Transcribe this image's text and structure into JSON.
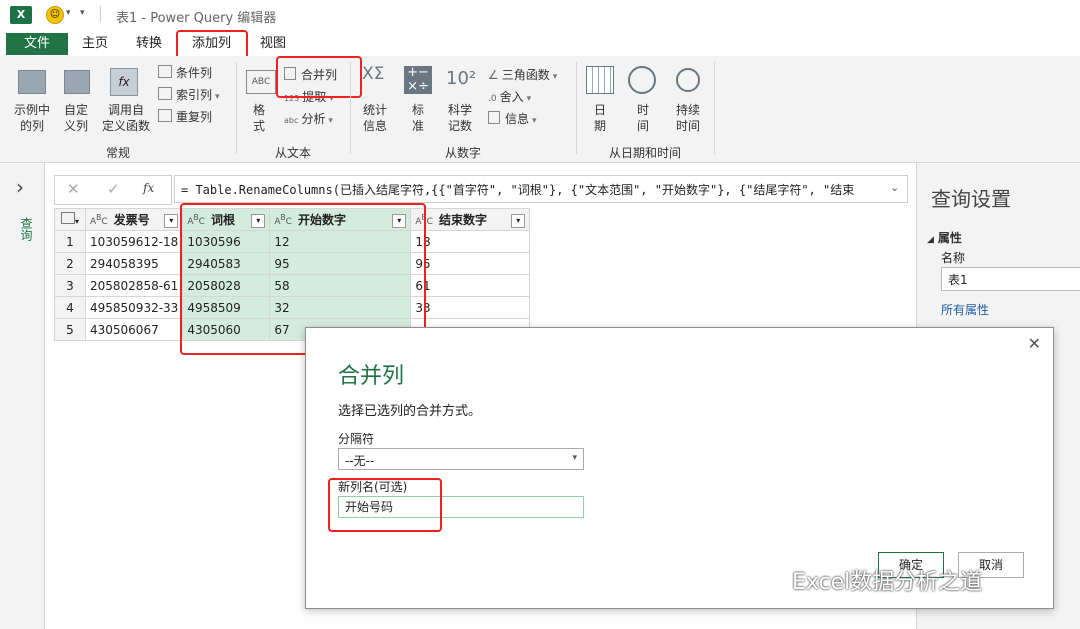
{
  "window": {
    "title": "表1 - Power Query 编辑器",
    "app_badge": "X"
  },
  "tabs": [
    "文件",
    "主页",
    "转换",
    "添加列",
    "视图"
  ],
  "ribbon": {
    "general": {
      "label": "常规",
      "btn_example": [
        "示例中",
        "的列"
      ],
      "btn_custom": [
        "自定",
        "义列"
      ],
      "btn_invoke": [
        "调用自",
        "定义函数"
      ],
      "small_items": [
        "条件列",
        "索引列",
        "重复列"
      ]
    },
    "text": {
      "label": "从文本",
      "btn_format": [
        "格",
        "式"
      ],
      "small_items": [
        "合并列",
        "提取",
        "分析"
      ],
      "abc_tag": "ABC",
      "num_tag": "123"
    },
    "number": {
      "label": "从数字",
      "btn_stats": [
        "统计",
        "信息"
      ],
      "btn_standard": [
        "标",
        "准"
      ],
      "btn_scientific": [
        "科学",
        "记数"
      ],
      "small_items": [
        "三角函数",
        "舍入",
        "信息"
      ],
      "sci_glyph": "10²",
      "sigma_glyph": "XΣ"
    },
    "datetime": {
      "label": "从日期和时间",
      "btn_date": [
        "日",
        "期"
      ],
      "btn_time": [
        "时",
        "间"
      ],
      "btn_duration": [
        "持续",
        "时间"
      ]
    }
  },
  "left_nav": {
    "label": "查询",
    "arrow": "›"
  },
  "formula_bar": {
    "cancel": "✕",
    "confirm": "✓",
    "fx": "fx",
    "text": "= Table.RenameColumns(已插入结尾字符,{{\"首字符\", \"词根\"}, {\"文本范围\", \"开始数字\"}, {\"结尾字符\", \"结束"
  },
  "table": {
    "headers": [
      "发票号",
      "词根",
      "开始数字",
      "结束数字"
    ],
    "rows": [
      [
        "1",
        "103059612-18",
        "1030596",
        "12",
        "18"
      ],
      [
        "2",
        "294058395",
        "2940583",
        "95",
        "95"
      ],
      [
        "3",
        "205802858-61",
        "2058028",
        "58",
        "61"
      ],
      [
        "4",
        "495850932-33",
        "4958509",
        "32",
        "33"
      ],
      [
        "5",
        "430506067",
        "4305060",
        "67",
        ""
      ]
    ]
  },
  "query_settings": {
    "title": "查询设置",
    "section": "属性",
    "name_label": "名称",
    "name_value": "表1",
    "all_props": "所有属性"
  },
  "dialog": {
    "title": "合并列",
    "subtitle": "选择已选列的合并方式。",
    "sep_label": "分隔符",
    "sep_value": "--无--",
    "newcol_label": "新列名(可选)",
    "newcol_value": "开始号码",
    "ok": "确定",
    "cancel": "取消",
    "close": "✕"
  },
  "watermark": "Excel数据分析之道",
  "colors": {
    "accent_green": "#217346",
    "selection": "#d4ecdf",
    "highlight_red": "#e22222"
  }
}
